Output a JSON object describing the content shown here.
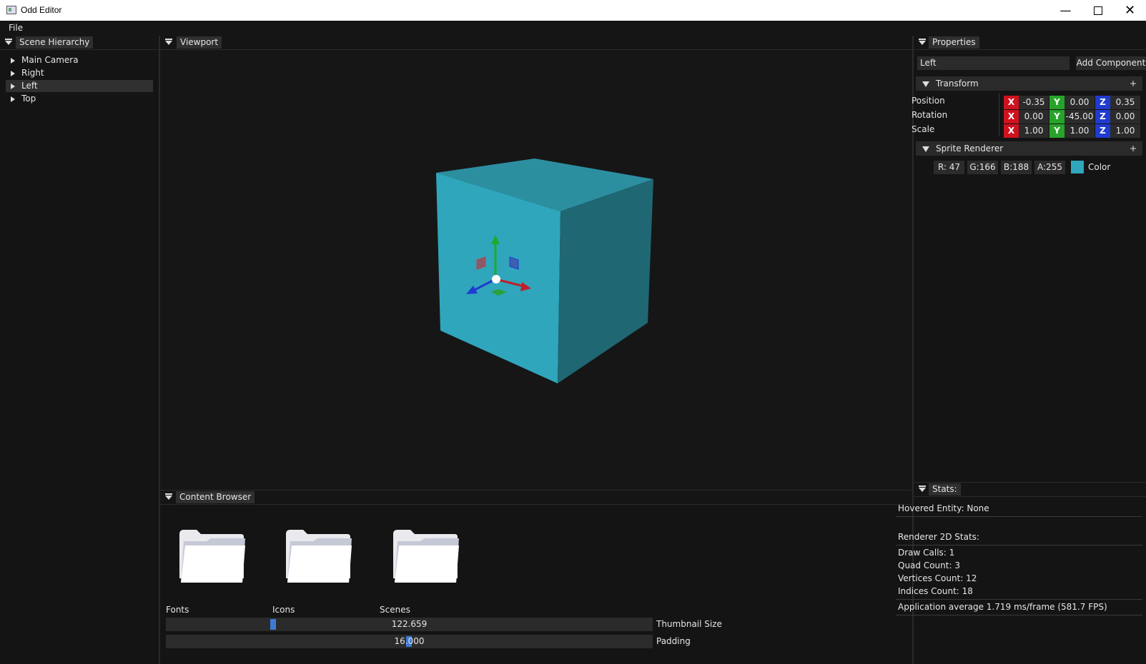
{
  "window": {
    "title": "Odd Editor"
  },
  "menu": {
    "file": "File"
  },
  "hierarchy": {
    "tab": "Scene Hierarchy",
    "items": [
      {
        "label": "Main Camera",
        "selected": false
      },
      {
        "label": "Right",
        "selected": false
      },
      {
        "label": "Left",
        "selected": true
      },
      {
        "label": "Top",
        "selected": false
      }
    ]
  },
  "viewport": {
    "tab": "Viewport",
    "cube_color": "#2fa6bc"
  },
  "properties": {
    "tab": "Properties",
    "entity_name": "Left",
    "add_component": "Add Component",
    "transform": {
      "title": "Transform",
      "plus": "+",
      "rows": [
        {
          "label": "Position",
          "x": "-0.35",
          "y": "0.00",
          "z": "0.35"
        },
        {
          "label": "Rotation",
          "x": "0.00",
          "y": "-45.00",
          "z": "0.00"
        },
        {
          "label": "Scale",
          "x": "1.00",
          "y": "1.00",
          "z": "1.00"
        }
      ],
      "axis_x": "X",
      "axis_y": "Y",
      "axis_z": "Z"
    },
    "sprite_renderer": {
      "title": "Sprite Renderer",
      "plus": "+",
      "r": "R: 47",
      "g": "G:166",
      "b": "B:188",
      "a": "A:255",
      "color_label": "Color",
      "swatch": "#2fa6bc"
    }
  },
  "stats": {
    "tab": "Stats:",
    "hovered": "Hovered Entity: None",
    "renderer_title": "Renderer 2D Stats:",
    "draw_calls": "Draw Calls: 1",
    "quad_count": "Quad Count: 3",
    "vertices": "Vertices Count: 12",
    "indices": "Indices Count: 18",
    "app_avg": "Application average 1.719 ms/frame (581.7 FPS)"
  },
  "content_browser": {
    "tab": "Content Browser",
    "folders": [
      "Fonts",
      "Icons",
      "Scenes"
    ],
    "thumbnail_value": "122.659",
    "thumbnail_label": "Thumbnail Size",
    "padding_value": "16.000",
    "padding_label": "Padding"
  }
}
